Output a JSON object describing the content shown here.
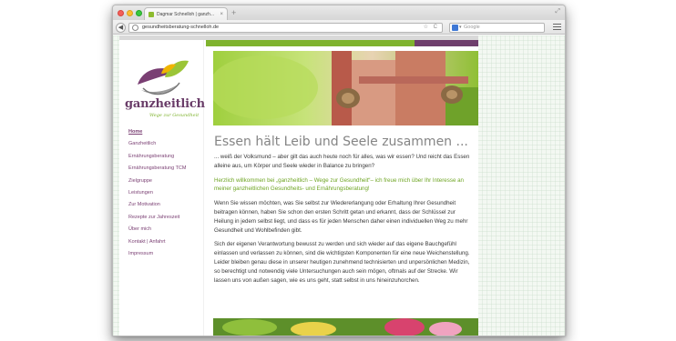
{
  "browser": {
    "tab_title": "Dagmar Schnelloh | ganzh...",
    "tab_close": "×",
    "new_tab": "+",
    "back": "◀",
    "url": "gesundheitsberatung-schnelloh.de",
    "url_actions": "☆ C",
    "search_placeholder": "Google",
    "search_chevron": "▾",
    "resize_glyph": "⤢"
  },
  "logo": {
    "word": "ganzheitlich",
    "subtitle": "Wege zur Gesundheit"
  },
  "nav": {
    "items": [
      "Home",
      "Ganzheitlich",
      "Ernährungsberatung",
      "Ernährungsberatung TCM",
      "Zielgruppe",
      "Leistungen",
      "Zur Motivation",
      "Rezepte zur Jahreszeit",
      "Über mich",
      "Kontakt | Anfahrt",
      "Impressum"
    ],
    "active_index": 0
  },
  "content": {
    "headline": "Essen hält Leib und Seele zusammen ...",
    "p1": "... weiß der Volksmund – aber gilt das auch heute noch für alles, was wir essen? Und reicht das Essen alleine aus, um Körper und Seele wieder in Balance zu bringen?",
    "p2": "Herzlich willkommen bei „ganzheitlich – Wege zur Gesundheit“– ich freue mich über Ihr Interesse an meiner ganzheitlichen Gesundheits- und Ernährungsberatung!",
    "p3": "Wenn Sie wissen möchten, was Sie selbst zur Wiedererlangung oder Erhaltung Ihrer Gesundheit beitragen können, haben Sie schon den ersten Schritt getan und erkannt, dass der Schlüssel zur Heilung in jedem selbst liegt, und dass es für jeden Menschen daher einen individuellen Weg zu mehr Gesundheit und Wohlbefinden gibt.",
    "p4": "Sich der eigenen Verantwortung bewusst zu werden und sich wieder auf das eigene Bauchgefühl einlassen und verlassen zu können, sind die wichtigsten Komponenten für eine neue Weichenstellung. Leider bleiben genau diese in unserer heutigen zunehmend technisierten und unpersönlichen Medizin, so berechtigt und notwendig viele Untersuchungen auch sein mögen, oftmals auf der Strecke. Wir lassen uns von außen sagen, wie es uns geht, statt selbst in uns hineinzuhorchen."
  },
  "colors": {
    "brand_purple": "#6f3f6d",
    "brand_green": "#7fb32e",
    "headline_gray": "#858585"
  }
}
